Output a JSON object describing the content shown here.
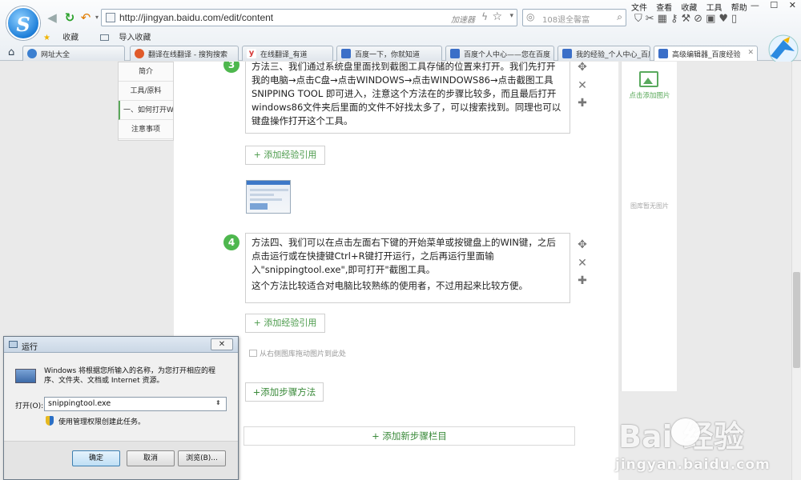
{
  "browser": {
    "url": "http://jingyan.baidu.com/edit/content",
    "accelerator": "加速器",
    "search_placeholder": "108退全馨富",
    "menus": [
      "文件",
      "查看",
      "收藏",
      "工具",
      "帮助"
    ],
    "bookmarks": [
      "收藏",
      "导入收藏"
    ],
    "tabs": [
      {
        "label": "网址大全",
        "color": "#3b7fd0"
      },
      {
        "label": "翻译在线翻译 - 搜狗搜索",
        "color": "#e05a2a"
      },
      {
        "label": "在线翻译_有道",
        "color": "#d63a3a"
      },
      {
        "label": "百度一下，你就知道",
        "color": "#3b6fc8"
      },
      {
        "label": "百度个人中心——您在百度",
        "color": "#3b6fc8"
      },
      {
        "label": "我的经验_个人中心_百度经验",
        "color": "#3b6fc8"
      },
      {
        "label": "高级编辑器_百度经验",
        "color": "#3b6fc8"
      }
    ]
  },
  "sidenav": {
    "items": [
      "简介",
      "工具/原料",
      "一、如何打开Win",
      "注意事项"
    ]
  },
  "steps": [
    {
      "number": "3",
      "text": "方法三、我们通过系统盘里面找到截图工具存储的位置来打开。我们先打开我的电脑→点击C盘→点击WINDOWS→点击WINDOWS86→点击截图工具SNIPPING TOOL 即可进入，注意这个方法在的步骤比较多，而且最后打开windows86文件夹后里面的文件不好找太多了，可以搜索找到。同理也可以键盘操作打开这个工具。",
      "extra": ""
    },
    {
      "number": "4",
      "text": "方法四、我们可以在点击左面右下键的开始菜单或按键盘上的WIN键，之后点击运行或在快捷键Ctrl+R键打开运行，之后再运行里面输入\"snippingtool.exe\",即可打开\"截图工具。",
      "extra": "这个方法比较适合对电脑比较熟练的使用者，不过用起来比较方便。"
    }
  ],
  "editor": {
    "add_ref": "+ 添加经验引用",
    "drag_hint": "从右侧图库拖动图片到此处",
    "add_method": "+添加步骤方法",
    "add_section": "+ 添加新步骤栏目"
  },
  "right_panel": {
    "add_pic": "点击添加图片",
    "empty": "图库暂无图片"
  },
  "watermark": {
    "brand": "Bai  经验",
    "url": "jingyan.baidu.com"
  },
  "run_dialog": {
    "title": "运行",
    "close": "✕",
    "description": "Windows 将根据您所输入的名称，为您打开相应的程序、文件夹、文档或 Internet 资源。",
    "open_label": "打开(O):",
    "input_value": "snippingtool.exe",
    "admin_text": "使用管理权限创建此任务。",
    "ok": "确定",
    "cancel": "取消",
    "browse": "浏览(B)..."
  }
}
